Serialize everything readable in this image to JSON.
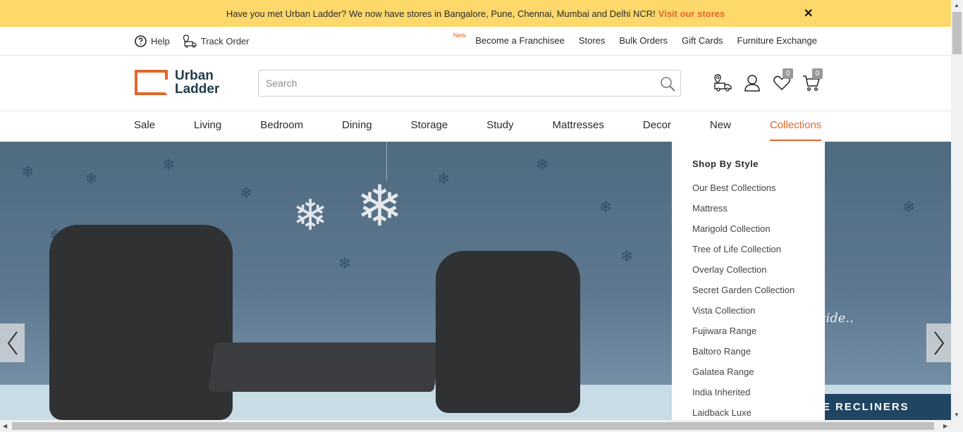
{
  "announcement": {
    "text": "Have you met Urban Ladder? We now have stores in Bangalore, Pune, Chennai, Mumbai and Delhi NCR!",
    "link": "Visit our stores",
    "close": "✕"
  },
  "utility": {
    "help": "Help",
    "track_order": "Track Order",
    "new_tag": "New",
    "links": [
      "Become a Franchisee",
      "Stores",
      "Bulk Orders",
      "Gift Cards",
      "Furniture Exchange"
    ]
  },
  "header": {
    "logo_line1": "Urban",
    "logo_line2": "Ladder",
    "search_placeholder": "Search",
    "wishlist_count": "0",
    "cart_count": "0"
  },
  "nav": {
    "items": [
      "Sale",
      "Living",
      "Bedroom",
      "Dining",
      "Storage",
      "Study",
      "Mattresses",
      "Decor",
      "New",
      "Collections"
    ],
    "active": "Collections"
  },
  "hero": {
    "script_text": "tside..",
    "banner_text": "RE RECLINERS",
    "prev": "‹",
    "next": "›"
  },
  "dropdown": {
    "heading": "Shop By Style",
    "items": [
      "Our Best Collections",
      "Mattress",
      "Marigold Collection",
      "Tree of Life Collection",
      "Overlay Collection",
      "Secret Garden Collection",
      "Vista Collection",
      "Fujiwara Range",
      "Baltoro Range",
      "Galatea Range",
      "India Inherited",
      "Laidback Luxe"
    ]
  },
  "colors": {
    "accent": "#e1672d",
    "announcement_bg": "#fdd86a",
    "banner_bg": "#1f4563"
  }
}
